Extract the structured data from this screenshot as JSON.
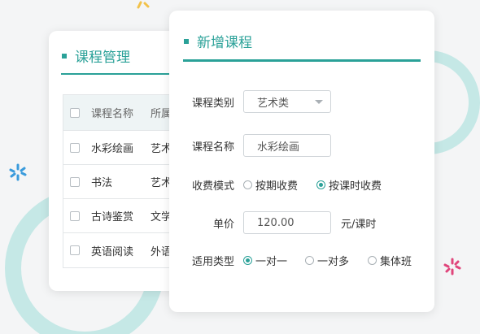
{
  "colors": {
    "accent": "#2aa198",
    "ring": "#c5e8e6",
    "spark_blue": "#3a9bdc",
    "spark_pink": "#e0457b",
    "spark_yellow": "#f2c24a"
  },
  "course_list": {
    "title": "课程管理",
    "columns": [
      "课程名称",
      "所属"
    ],
    "rows": [
      {
        "name": "水彩绘画",
        "category": "艺术"
      },
      {
        "name": "书法",
        "category": "艺术"
      },
      {
        "name": "古诗鉴赏",
        "category": "文学"
      },
      {
        "name": "英语阅读",
        "category": "外语"
      }
    ]
  },
  "new_course": {
    "title": "新增课程",
    "category": {
      "label": "课程类别",
      "value": "艺术类"
    },
    "name": {
      "label": "课程名称",
      "value": "水彩绘画"
    },
    "billing": {
      "label": "收费模式",
      "options": [
        "按期收费",
        "按课时收费"
      ],
      "selected": "按课时收费"
    },
    "price": {
      "label": "单价",
      "value": "120.00",
      "unit": "元/课时"
    },
    "type": {
      "label": "适用类型",
      "options": [
        "一对一",
        "一对多",
        "集体班"
      ],
      "selected": "一对一"
    }
  }
}
